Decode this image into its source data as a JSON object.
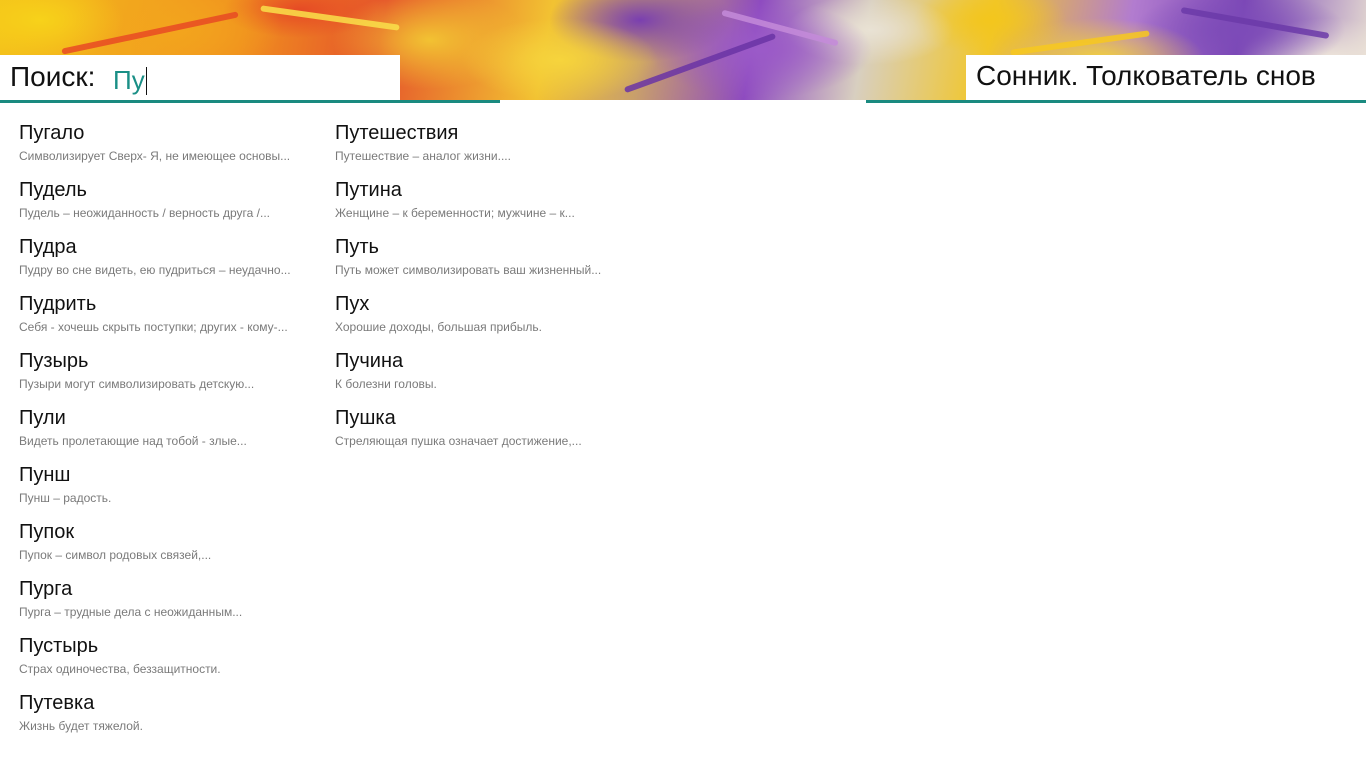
{
  "search": {
    "label": "Поиск:",
    "value": "Пу"
  },
  "app": {
    "title": "Сонник. Толкователь снов",
    "accent_color": "#1a8a80"
  },
  "results": {
    "columns": [
      [
        {
          "title": "Пугало",
          "desc": "Символизирует Сверх- Я, не имеющее основы..."
        },
        {
          "title": "Пудель",
          "desc": "Пудель – неожиданность / верность друга /..."
        },
        {
          "title": "Пудра",
          "desc": "Пудру во сне видеть, ею пудриться – неудачно..."
        },
        {
          "title": "Пудрить",
          "desc": "Себя - хочешь скрыть поступки; других - кому-..."
        },
        {
          "title": "Пузырь",
          "desc": "Пузыри могут символизировать детскую..."
        },
        {
          "title": "Пули",
          "desc": "Видеть пролетающие над тобой - злые..."
        },
        {
          "title": "Пунш",
          "desc": "Пунш – радость."
        },
        {
          "title": "Пупок",
          "desc": "Пупок – символ родовых связей,..."
        },
        {
          "title": "Пурга",
          "desc": "Пурга – трудные дела с неожиданным..."
        },
        {
          "title": "Пустырь",
          "desc": "Страх одиночества, беззащитности."
        },
        {
          "title": "Путевка",
          "desc": "Жизнь будет тяжелой."
        }
      ],
      [
        {
          "title": "Путешествия",
          "desc": "Путешествие – аналог жизни...."
        },
        {
          "title": "Путина",
          "desc": "Женщине – к беременности; мужчине – к..."
        },
        {
          "title": "Путь",
          "desc": "Путь может символизировать ваш жизненный..."
        },
        {
          "title": "Пух",
          "desc": "Хорошие доходы, большая прибыль."
        },
        {
          "title": "Пучина",
          "desc": "К болезни головы."
        },
        {
          "title": "Пушка",
          "desc": "Стреляющая пушка означает достижение,..."
        }
      ]
    ]
  }
}
